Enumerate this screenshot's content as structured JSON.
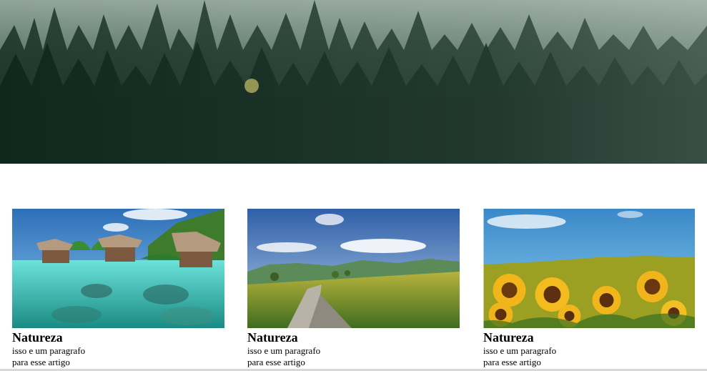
{
  "hero": {
    "alt": "misty forest header image"
  },
  "cards": [
    {
      "title": "Natureza",
      "text": "isso e um paragrafo\npara esse artigo",
      "image": "tropical-bungalows-image"
    },
    {
      "title": "Natureza",
      "text": "isso e um paragrafo\npara esse artigo",
      "image": "countryside-road-image"
    },
    {
      "title": "Natureza",
      "text": "isso e um paragrafo\npara esse artigo",
      "image": "sunflower-field-image"
    }
  ],
  "colors": {
    "background": "#ffffff",
    "text": "#000000"
  }
}
